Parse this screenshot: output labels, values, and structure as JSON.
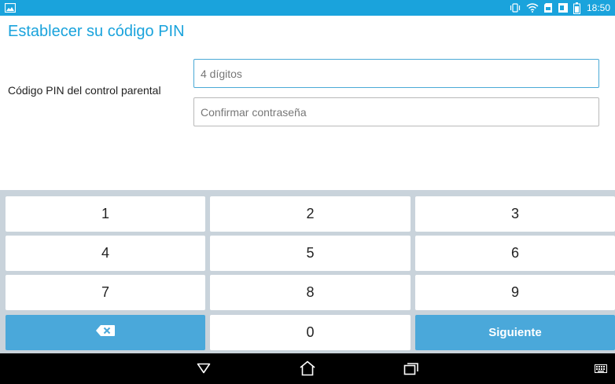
{
  "status_bar": {
    "time": "18:50",
    "icons": [
      "image-notification-icon",
      "vibrate-icon",
      "wifi-icon",
      "sd-card-icon",
      "battery-saver-icon",
      "battery-icon"
    ]
  },
  "header": {
    "title": "Establecer su código PIN"
  },
  "form": {
    "label": "Código PIN del control parental",
    "pin_placeholder": "4 dígitos",
    "pin_value": "",
    "confirm_placeholder": "Confirmar contraseña",
    "confirm_value": ""
  },
  "keypad": {
    "keys": [
      "1",
      "2",
      "3",
      "4",
      "5",
      "6",
      "7",
      "8",
      "9"
    ],
    "zero": "0",
    "next_label": "Siguiente",
    "backspace_icon": "backspace-icon"
  },
  "nav_bar": {
    "icons": [
      "back-icon",
      "home-icon",
      "recents-icon",
      "keyboard-icon"
    ]
  },
  "colors": {
    "accent": "#1aa3dc",
    "key_blue": "#4aa8da",
    "keypad_bg": "#c9d3db"
  }
}
